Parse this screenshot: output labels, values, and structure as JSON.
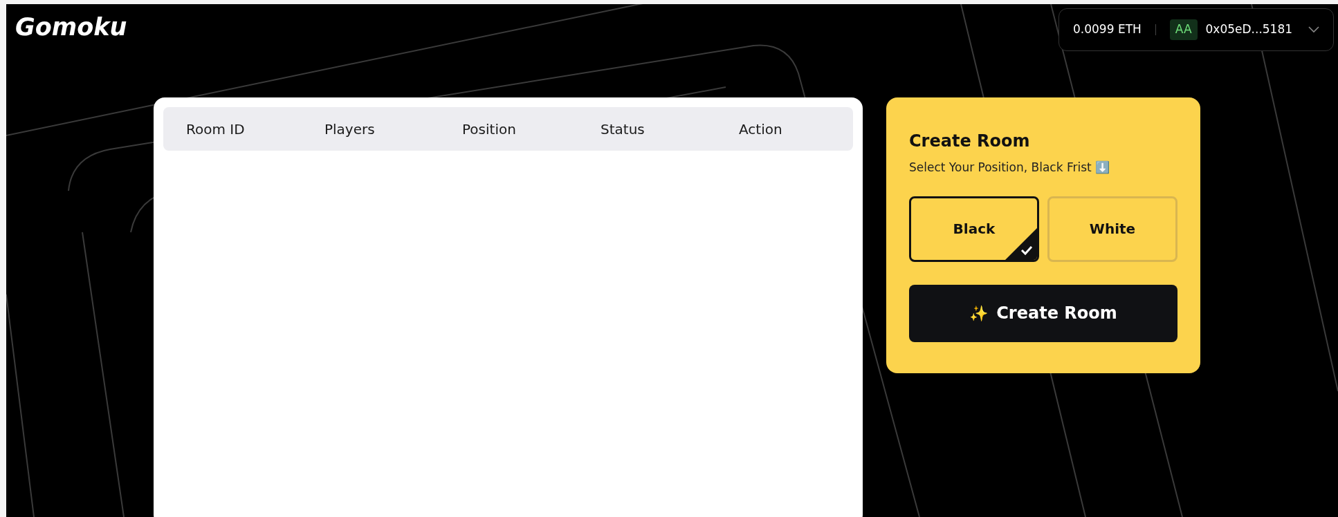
{
  "app": {
    "logo": "Gomoku"
  },
  "wallet": {
    "balance": "0.0099 ETH",
    "badge": "AA",
    "address": "0x05eD...5181"
  },
  "table": {
    "columns": [
      "Room ID",
      "Players",
      "Position",
      "Status",
      "Action"
    ]
  },
  "create_room": {
    "title": "Create Room",
    "subtitle": "Select Your Position, Black Frist ⬇️",
    "options": [
      {
        "label": "Black",
        "selected": true
      },
      {
        "label": "White",
        "selected": false
      }
    ],
    "button": {
      "icon": "✨",
      "label": "Create Room"
    }
  }
}
